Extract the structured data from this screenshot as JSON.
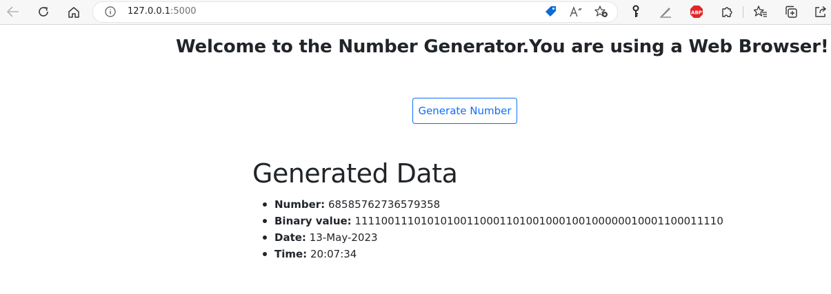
{
  "browser": {
    "url_host": "127.0.0.1",
    "url_port": ":5000",
    "icons": {
      "back": "back-arrow-icon",
      "refresh": "refresh-icon",
      "home": "home-icon",
      "info": "info-icon",
      "tag": "price-tag-icon",
      "read_aloud": "read-aloud-icon",
      "favorite_add": "add-favorite-icon",
      "key": "key-icon",
      "extension_pen": "extension-pen-icon",
      "adblock": "adblock-icon",
      "extensions": "puzzle-icon",
      "favorites": "favorites-icon",
      "collections": "collections-icon",
      "share": "share-icon"
    },
    "adblock_label": "ABP",
    "colors": {
      "tag": "#0a6cd6",
      "adblock": "#e0272b"
    }
  },
  "page": {
    "welcome": "Welcome to the Number Generator.You are using a Web Browser!!",
    "button_label": "Generate Number",
    "data_title": "Generated Data",
    "items": [
      {
        "label": "Number:",
        "value": "68585762736579358"
      },
      {
        "label": "Binary value:",
        "value": "11110011101010100110001101001000100100000010001100011110"
      },
      {
        "label": "Date:",
        "value": "13-May-2023"
      },
      {
        "label": "Time:",
        "value": "20:07:34"
      }
    ],
    "colors": {
      "accent": "#0d6efd",
      "text": "#212529"
    }
  }
}
